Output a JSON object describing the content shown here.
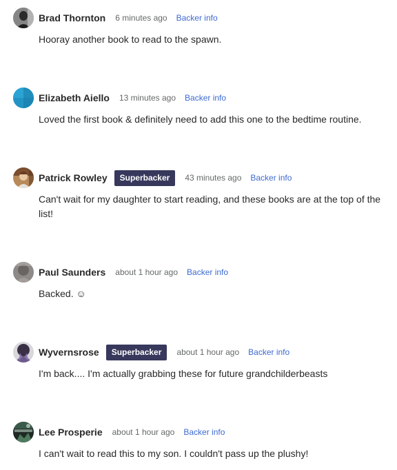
{
  "comments": [
    {
      "author": "Brad Thornton",
      "badge": "",
      "time": "6 minutes ago",
      "backer_link": "Backer info",
      "body": "Hooray another book to read to the spawn.",
      "avatar_icon": "grayscale-portrait-avatar"
    },
    {
      "author": "Elizabeth Aiello",
      "badge": "",
      "time": "13 minutes ago",
      "backer_link": "Backer info",
      "body": "Loved the first book & definitely need to add this one to the bedtime routine.",
      "avatar_icon": "blue-default-avatar"
    },
    {
      "author": "Patrick Rowley",
      "badge": "Superbacker",
      "time": "43 minutes ago",
      "backer_link": "Backer info",
      "body": "Can't wait for my daughter to start reading, and these books are at the top of the list!",
      "avatar_icon": "photo-avatar"
    },
    {
      "author": "Paul Saunders",
      "badge": "",
      "time": "about 1 hour ago",
      "backer_link": "Backer info",
      "body": "Backed. ☺",
      "avatar_icon": "gray-blur-avatar"
    },
    {
      "author": "Wyvernsrose",
      "badge": "Superbacker",
      "time": "about 1 hour ago",
      "backer_link": "Backer info",
      "body": "I'm back.... I'm actually grabbing these for future grandchilderbeasts",
      "avatar_icon": "purple-figure-avatar"
    },
    {
      "author": "Lee Prosperie",
      "badge": "",
      "time": "about 1 hour ago",
      "backer_link": "Backer info",
      "body": "I can't wait to read this to my son. I couldn't pass up the plushy!",
      "avatar_icon": "dark-game-avatar"
    }
  ],
  "colors": {
    "author": "#282828",
    "badge_bg": "#37385c",
    "link": "#3d6ad2",
    "time": "#656969"
  }
}
